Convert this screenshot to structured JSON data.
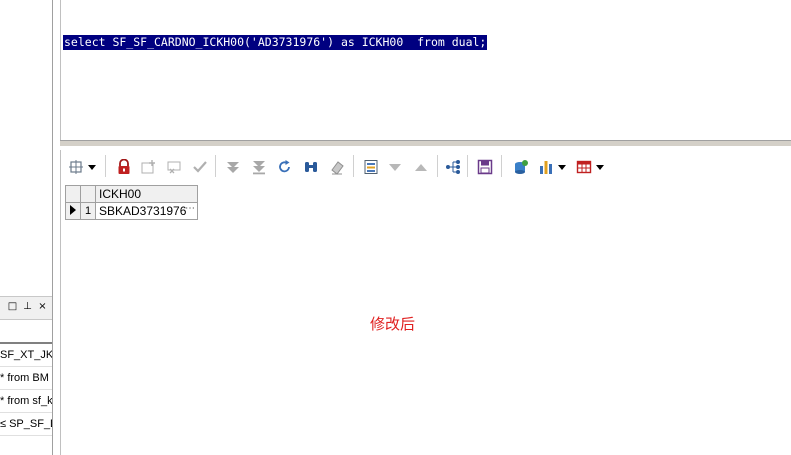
{
  "editor": {
    "sql": "select SF_SF_CARDNO_ICKH00('AD3731976') as ICKH00  from dual;"
  },
  "left_panel": {
    "header_buttons": [
      "□",
      "⊥",
      "×"
    ],
    "items": [
      "SF_XT_JKR",
      "* from BM",
      "* from sf_k",
      "≤ SP_SF_D"
    ]
  },
  "toolbar": {
    "icons": [
      "grid-settings-icon",
      "dropdown-arrow-icon",
      "lock-icon",
      "add-record-icon",
      "delete-record-icon",
      "post-changes-icon",
      "fetch-next-icon",
      "fetch-last-icon",
      "refresh-icon",
      "find-icon",
      "clear-icon",
      "form-view-icon",
      "sort-desc-icon",
      "sort-asc-icon",
      "query-by-example-icon",
      "save-icon",
      "export-icon",
      "chart-icon",
      "table-view-icon"
    ]
  },
  "grid": {
    "columns": [
      "ICKH00"
    ],
    "rows": [
      {
        "num": "1",
        "ICKH00": "SBKAD3731976",
        "more": "⋯"
      }
    ]
  },
  "annotation": {
    "text": "修改后",
    "color": "#e02020"
  },
  "colors": {
    "selection_bg": "#000080",
    "selection_fg": "#ffffff"
  }
}
